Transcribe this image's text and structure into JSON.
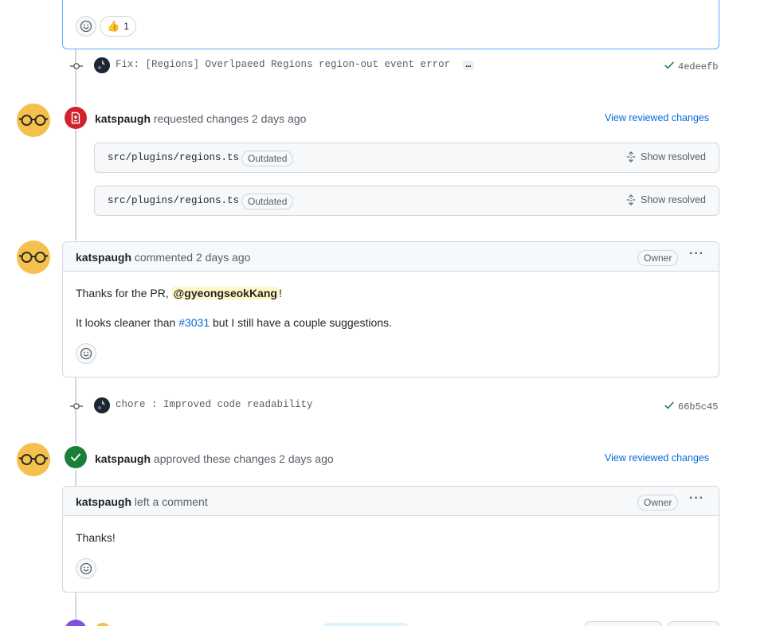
{
  "top_reactions": {
    "thumbs_emoji": "👍",
    "thumbs_count": "1"
  },
  "commit1": {
    "message": "Fix: [Regions] Overlpaeed Regions region-out event error",
    "ellipsis": "…",
    "sha": "4edeefb"
  },
  "review1": {
    "author": "katspaugh",
    "action": "requested changes",
    "time": "2 days ago",
    "view_link": "View reviewed changes",
    "files": [
      {
        "name": "src/plugins/regions.ts",
        "badge": "Outdated",
        "action": "Show resolved"
      },
      {
        "name": "src/plugins/regions.ts",
        "badge": "Outdated",
        "action": "Show resolved"
      }
    ]
  },
  "comment1": {
    "author": "katspaugh",
    "action": "commented",
    "time": "2 days ago",
    "role_badge": "Owner",
    "line1_prefix": "Thanks for the PR, ",
    "line1_mention": "@gyeongseokKang",
    "line1_suffix": "!",
    "line2_prefix": "It looks cleaner than ",
    "line2_link": "#3031",
    "line2_suffix": " but I still have a couple suggestions."
  },
  "commit2": {
    "message": "chore : Improved code readability",
    "sha": "66b5c45"
  },
  "review2": {
    "author": "katspaugh",
    "action": "approved these changes",
    "time": "2 days ago",
    "view_link": "View reviewed changes"
  },
  "comment2": {
    "author": "katspaugh",
    "action": "left a comment",
    "role_badge": "Owner",
    "body": "Thanks!"
  },
  "icons": {
    "smiley": "smiley-icon",
    "commit": "git-commit-icon",
    "check": "check-icon",
    "file_diff": "file-diff-icon",
    "unfold": "unfold-icon",
    "kebab": "kebab-horizontal-icon"
  },
  "colors": {
    "link": "#0969da",
    "changes_requested": "#cf222e",
    "approved": "#1a7f37",
    "mention_bg": "#fff8c5",
    "avatar": "#f5c04b"
  }
}
